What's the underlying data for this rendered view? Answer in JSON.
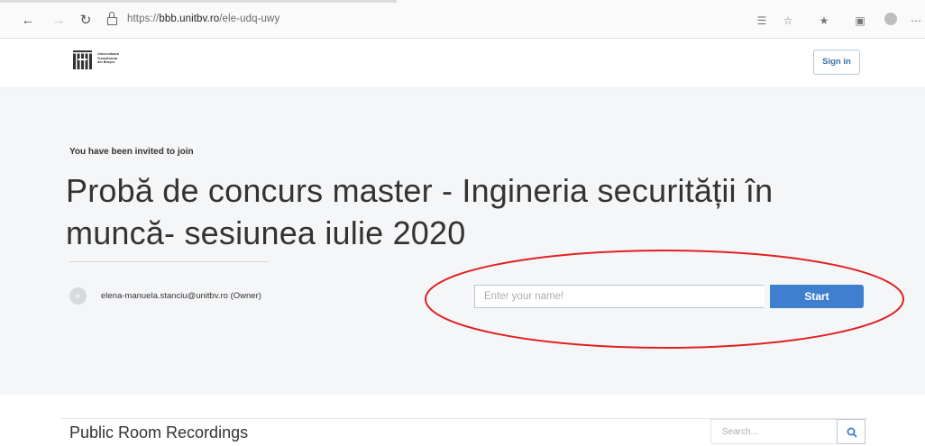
{
  "browser": {
    "url_prefix": "https://",
    "url_domain": "bbb.unitbv.ro",
    "url_path": "/ele-udq-uwy",
    "icons": [
      "back-icon",
      "forward-icon",
      "refresh-icon",
      "lock-icon",
      "read-aloud-icon",
      "favorite-icon",
      "favorites-list-icon",
      "collections-icon",
      "profile-icon",
      "more-icon"
    ]
  },
  "header": {
    "logo_lines": [
      "Universitatea",
      "Transilvania",
      "din Brașov"
    ],
    "sign_in_label": "Sign in"
  },
  "invite": {
    "label": "You have been invited to join",
    "room_title": "Probă de concurs master - Ingineria securității în muncă- sesiunea iulie 2020",
    "owner_initial": "e",
    "owner_text": "elena-manuela.stanciu@unitbv.ro (Owner)",
    "name_placeholder": "Enter your name!",
    "start_label": "Start"
  },
  "recordings": {
    "title": "Public Room Recordings",
    "search_placeholder": "Search..."
  },
  "colors": {
    "accent": "#3e80cf",
    "annotation": "#e02020",
    "band": "#f5f6f8"
  }
}
